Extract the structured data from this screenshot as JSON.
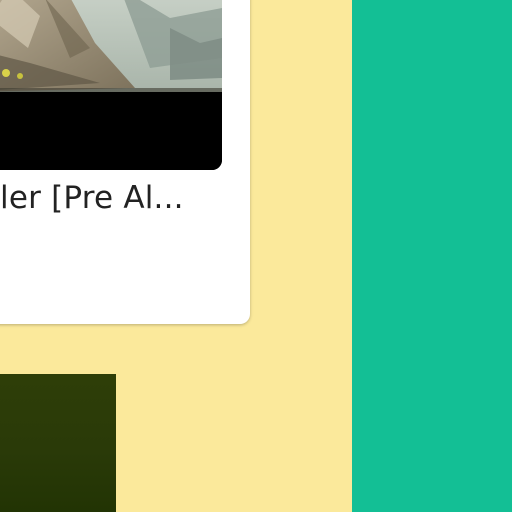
{
  "card": {
    "title": "ler [Pre Al..."
  },
  "colors": {
    "page_background": "#fbe99b",
    "side_panel": "#13bf95",
    "card_background": "#ffffff",
    "thumbnail_letterbox": "#000000",
    "video_tile": "#2e3e08"
  }
}
